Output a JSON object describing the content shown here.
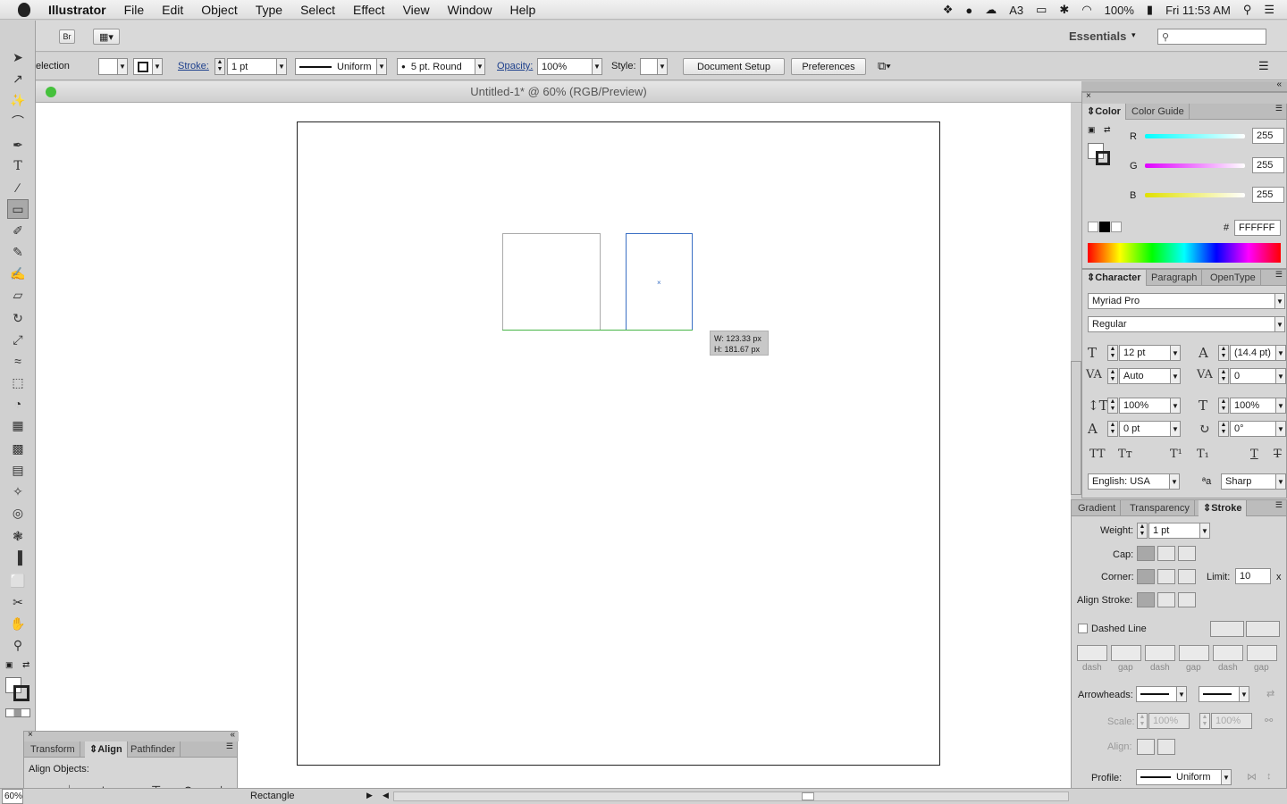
{
  "menubar": {
    "app": "Illustrator",
    "items": [
      "File",
      "Edit",
      "Object",
      "Type",
      "Select",
      "Effect",
      "View",
      "Window",
      "Help"
    ],
    "status_count": "3",
    "battery": "100%",
    "clock": "Fri 11:53 AM"
  },
  "appbar": {
    "br_label": "Br",
    "workspace": "Essentials",
    "search_placeholder": ""
  },
  "control": {
    "selection_label": "election",
    "stroke_label": "Stroke:",
    "stroke_weight": "1 pt",
    "stroke_profile": "Uniform",
    "brush": "5 pt. Round",
    "opacity_label": "Opacity:",
    "opacity": "100%",
    "style_label": "Style:",
    "document_setup": "Document Setup",
    "preferences": "Preferences"
  },
  "document": {
    "title": "Untitled-1* @ 60% (RGB/Preview)",
    "tooltip_w": "W: 123.33 px",
    "tooltip_h": "H: 181.67 px"
  },
  "color_panel": {
    "tabs": [
      "Color",
      "Color Guide"
    ],
    "r_label": "R",
    "r": "255",
    "g_label": "G",
    "g": "255",
    "b_label": "B",
    "b": "255",
    "hash": "#",
    "hex": "FFFFFF"
  },
  "character_panel": {
    "tabs": [
      "Character",
      "Paragraph",
      "OpenType"
    ],
    "font_family": "Myriad Pro",
    "font_style": "Regular",
    "size": "12 pt",
    "leading": "(14.4 pt)",
    "kerning": "Auto",
    "tracking": "0",
    "vscale": "100%",
    "hscale": "100%",
    "baseline": "0 pt",
    "rotation": "0°",
    "language": "English: USA",
    "antialias": "Sharp",
    "aa_label": "ªa"
  },
  "stroke_panel": {
    "tabs": [
      "Gradient",
      "Transparency",
      "Stroke"
    ],
    "weight_label": "Weight:",
    "weight": "1 pt",
    "cap_label": "Cap:",
    "corner_label": "Corner:",
    "limit_label": "Limit:",
    "limit": "10",
    "limit_x": "x",
    "align_label": "Align Stroke:",
    "dashed_label": "Dashed Line",
    "dash_labels": [
      "dash",
      "gap",
      "dash",
      "gap",
      "dash",
      "gap"
    ],
    "arrowheads_label": "Arrowheads:",
    "scale_label": "Scale:",
    "scale1": "100%",
    "scale2": "100%",
    "align2_label": "Align:",
    "profile_label": "Profile:",
    "profile": "Uniform"
  },
  "align_panel": {
    "tabs": [
      "Transform",
      "Align",
      "Pathfinder"
    ],
    "align_objects": "Align Objects:"
  },
  "status": {
    "zoom": "60%",
    "tool": "Rectangle"
  }
}
